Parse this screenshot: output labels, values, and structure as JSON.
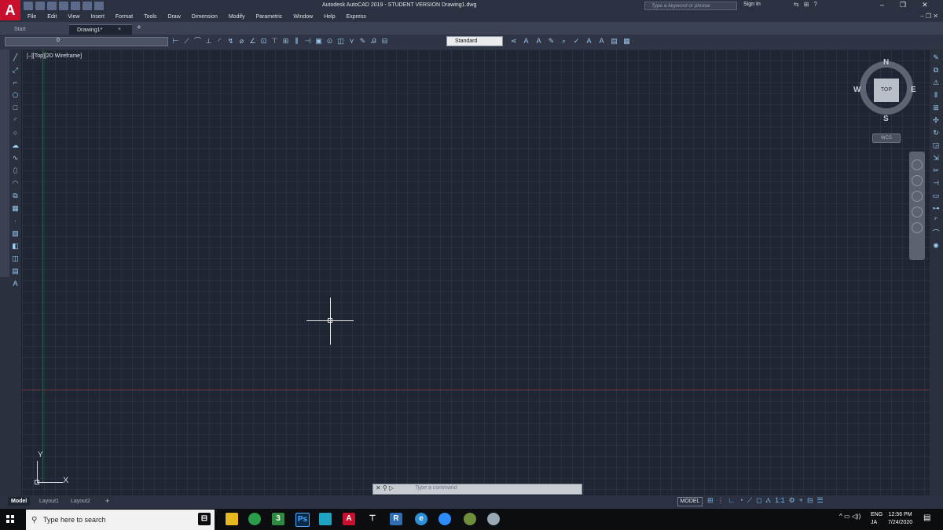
{
  "app": {
    "logo_letter": "A",
    "window_title": "Autodesk AutoCAD 2019 - STUDENT VERSION    Drawing1.dwg",
    "search_placeholder": "Type a keyword or phrase",
    "sign_in": "Sign In"
  },
  "menus": [
    "File",
    "Edit",
    "View",
    "Insert",
    "Format",
    "Tools",
    "Draw",
    "Dimension",
    "Modify",
    "Parametric",
    "Window",
    "Help",
    "Express"
  ],
  "tabs": {
    "start": "Start",
    "drawing": "Drawing1*",
    "close": "×",
    "add": "+"
  },
  "toolbar": {
    "current_layer": "0",
    "text_style": "Standard"
  },
  "viewport": {
    "label": "[–][Top][2D Wireframe]"
  },
  "ucs": {
    "x_label": "X",
    "y_label": "Y"
  },
  "viewcube": {
    "top": "TOP",
    "north": "N",
    "south": "S",
    "east": "E",
    "west": "W",
    "wcs": "WCS"
  },
  "command_line": {
    "placeholder": "Type a command"
  },
  "layout_tabs": {
    "model": "Model",
    "layout1": "Layout1",
    "layout2": "Layout2",
    "add": "+"
  },
  "statusbar": {
    "model_button": "MODEL",
    "scale": "1:1"
  },
  "taskbar": {
    "search_placeholder": "Type here to search",
    "language_line1": "ENG",
    "language_line2": "JA",
    "time": "12:56 PM",
    "date": "7/24/2020"
  },
  "colors": {
    "canvas": "#1f2533",
    "x_axis": "#6b2b35",
    "y_axis": "#2f5f44",
    "crosshair": "#e8e8e8",
    "brand_red": "#c8102e"
  },
  "icons": {
    "taskbar_apps": [
      "task-view-icon",
      "file-explorer-icon",
      "chrome-icon",
      "calendar-app-icon",
      "photoshop-icon",
      "app-icon",
      "autocad-icon",
      "network-app-icon",
      "revit-icon",
      "edge-icon",
      "zoom-icon",
      "paint-icon",
      "cloud-app-icon"
    ]
  }
}
